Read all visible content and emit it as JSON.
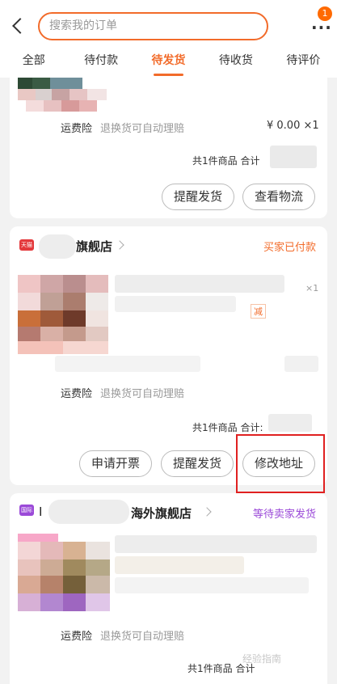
{
  "search": {
    "placeholder": "搜索我的订单"
  },
  "more": {
    "badge": "1"
  },
  "tabs": [
    {
      "label": "全部"
    },
    {
      "label": "待付款"
    },
    {
      "label": "待发货",
      "active": true
    },
    {
      "label": "待收货"
    },
    {
      "label": "待评价"
    }
  ],
  "orders": [
    {
      "insurance_label": "运费险",
      "insurance_text": "退换货可自动理赔",
      "price": "¥ 0.00 ×1",
      "total": "共1件商品 合计",
      "buttons": [
        "提醒发货",
        "查看物流"
      ]
    },
    {
      "shop_logo": "天猫",
      "shop_name": "旗舰店",
      "status": "买家已付款",
      "qty": "×1",
      "tag": "减",
      "insurance_label": "运费险",
      "insurance_text": "退换货可自动理赔",
      "total": "共1件商品 合计:",
      "buttons": [
        "申请开票",
        "提醒发货",
        "修改地址"
      ]
    },
    {
      "shop_logo": "国际",
      "shop_prefix": "I",
      "shop_name": "海外旗舰店",
      "status": "等待卖家发货",
      "insurance_label": "运费险",
      "insurance_text": "退换货可自动理赔",
      "total": "共1件商品 合计"
    }
  ],
  "colors": {
    "accent": "#f26b2a",
    "highlight": "#e02020",
    "intl": "#9b4ad8"
  },
  "watermark": "经验指南"
}
